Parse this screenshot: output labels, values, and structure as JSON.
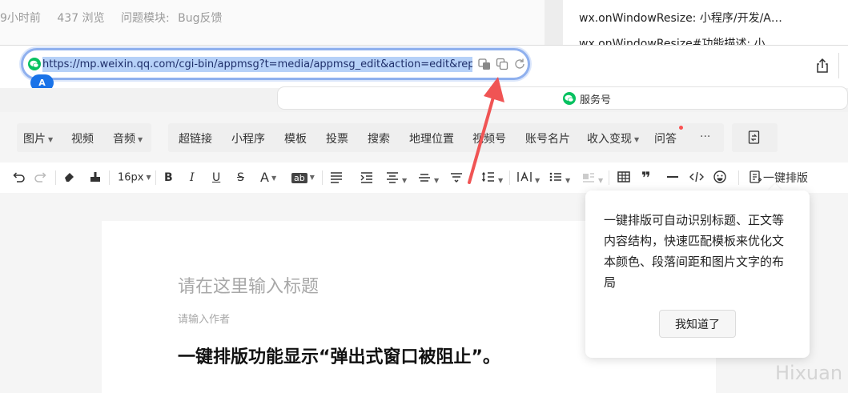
{
  "forum": {
    "time_ago": "9小时前",
    "views": "437 浏览",
    "module_label": "问题模块:",
    "module_value": "Bug反馈",
    "related": [
      "wx.onWindowResize: 小程序/开发/API/...",
      "wx.onWindowResize#功能描述: 小程序..."
    ]
  },
  "browser": {
    "url": "https://mp.weixin.qq.com/cgi-bin/appmsg?t=media/appmsg_edit&action=edit&reprint_co",
    "profile_badge": "A",
    "tab_title": "服务号",
    "icons": [
      "wechat-icon",
      "translate-icon",
      "copy-icon",
      "reload-icon",
      "share-icon"
    ]
  },
  "insert_toolbar": {
    "group1": [
      {
        "label": "图片",
        "dropdown": true
      },
      {
        "label": "视频",
        "dropdown": false
      },
      {
        "label": "音频",
        "dropdown": true
      }
    ],
    "group2": [
      {
        "label": "超链接",
        "dropdown": false
      },
      {
        "label": "小程序",
        "dropdown": false
      },
      {
        "label": "模板",
        "dropdown": false
      },
      {
        "label": "投票",
        "dropdown": false
      },
      {
        "label": "搜索",
        "dropdown": false
      },
      {
        "label": "地理位置",
        "dropdown": false
      },
      {
        "label": "视频号",
        "dropdown": false
      },
      {
        "label": "账号名片",
        "dropdown": false
      },
      {
        "label": "收入变现",
        "dropdown": true
      },
      {
        "label": "问答",
        "dropdown": false
      },
      {
        "label": "···",
        "dropdown": false
      }
    ]
  },
  "format_toolbar": {
    "font_size": "16px",
    "bold": "B",
    "italic": "I",
    "underline": "U",
    "strike": "S",
    "font_color": "A",
    "highlight": "ab",
    "quote": "❞",
    "one_click_layout": "一键排版"
  },
  "editor": {
    "title_placeholder": "请在这里输入标题",
    "author_placeholder": "请输入作者",
    "heading": "一键排版功能显示“弹出式窗口被阻止”。"
  },
  "popover": {
    "text": "一键排版可自动识别标题、正文等内容结构，快速匹配模板来优化文本颜色、段落间距和图片文字的布局",
    "button": "我知道了"
  },
  "watermark": "Hixuan",
  "colors": {
    "wechat_green": "#07c160",
    "highlight_blue": "#b6d1f8",
    "arrow_red": "#f05454",
    "badge_blue": "#1a73e8"
  }
}
